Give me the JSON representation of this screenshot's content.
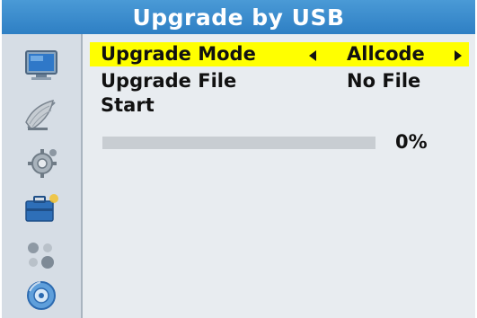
{
  "window": {
    "title": "Upgrade by USB"
  },
  "sidebar": {
    "icons": [
      {
        "name": "tv-icon"
      },
      {
        "name": "satellite-dish-icon"
      },
      {
        "name": "settings-gear-icon"
      },
      {
        "name": "toolbox-icon"
      },
      {
        "name": "games-icon"
      },
      {
        "name": "media-disc-icon"
      }
    ]
  },
  "menu": {
    "items": [
      {
        "label": "Upgrade Mode",
        "value": "Allcode",
        "selected": true
      },
      {
        "label": "Upgrade File",
        "value": "No File",
        "selected": false
      },
      {
        "label": "Start",
        "value": "",
        "selected": false
      }
    ]
  },
  "progress": {
    "value": 0,
    "text": "0%"
  },
  "colors": {
    "title_bar": "#2e7fc4",
    "highlight": "#ffff00",
    "sidebar_bg": "#d6dde5",
    "content_bg": "#e8ecf0"
  }
}
